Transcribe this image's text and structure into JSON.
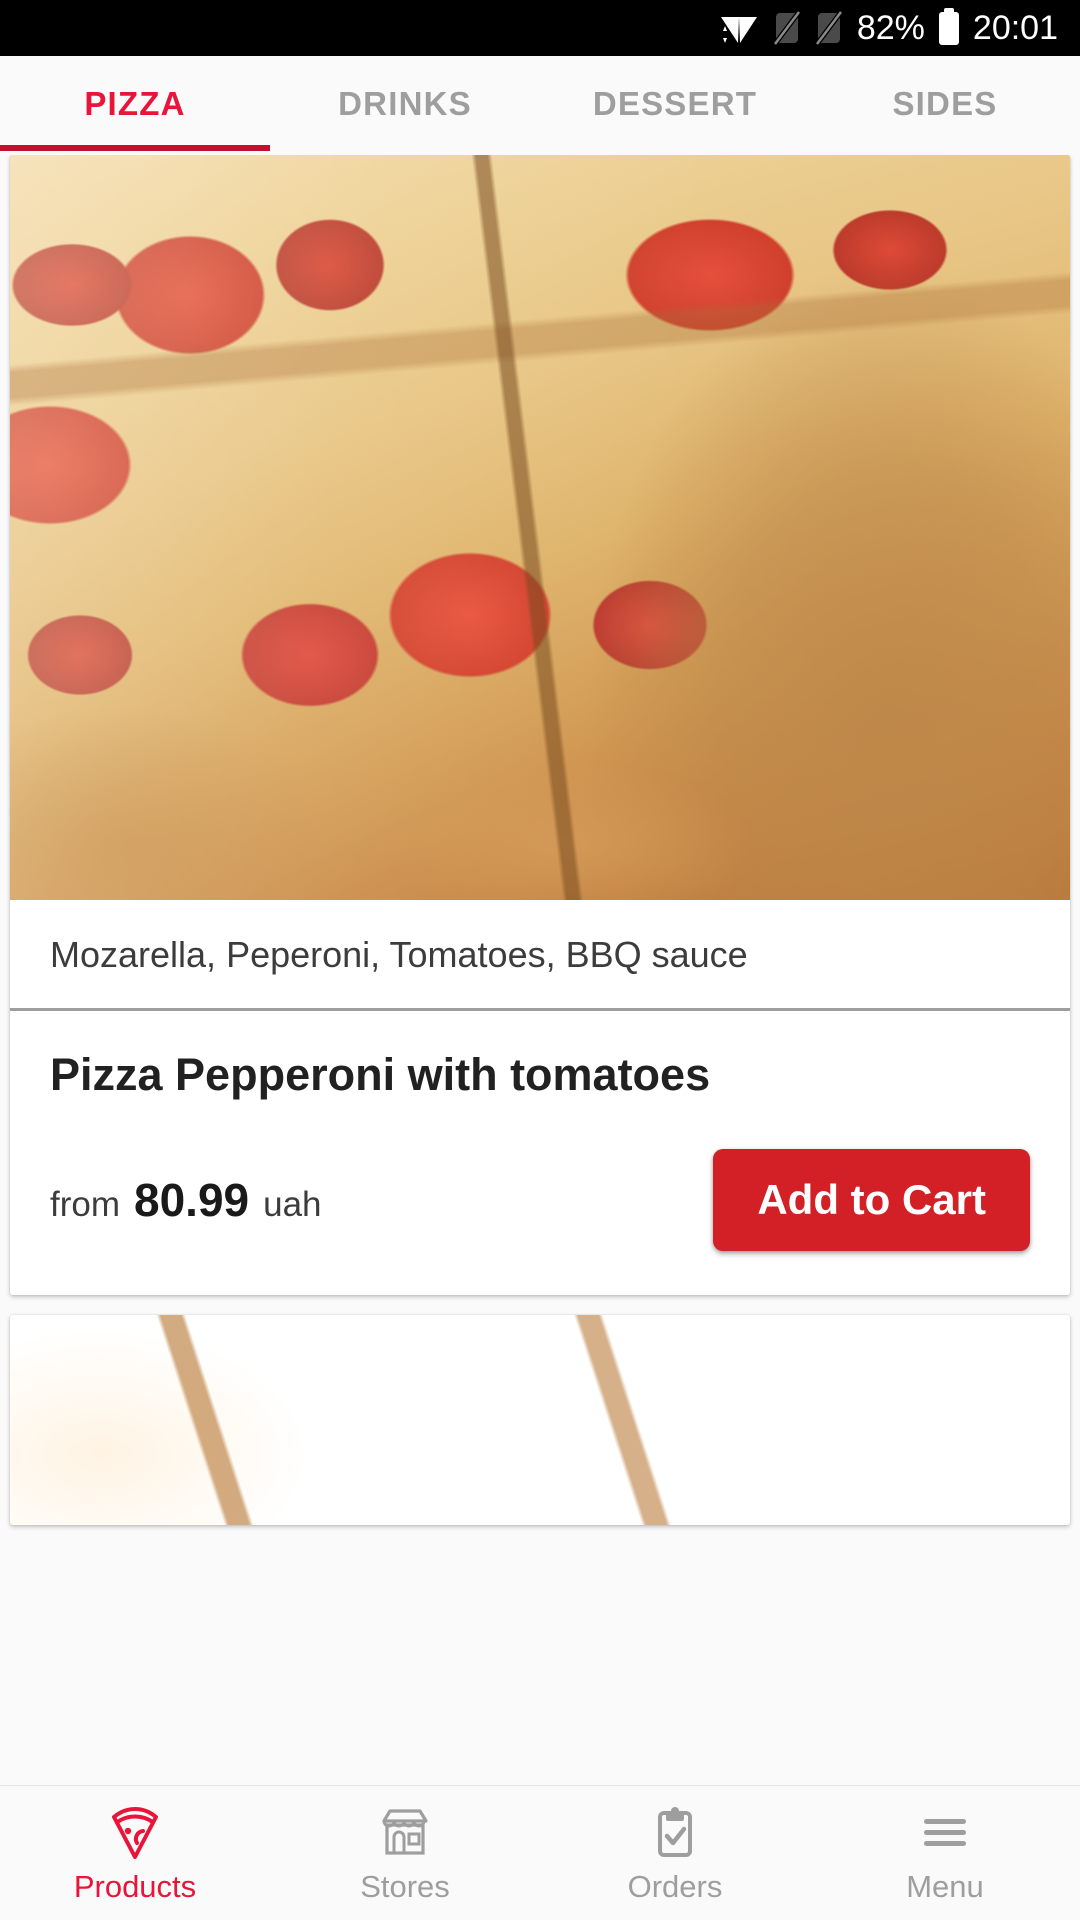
{
  "status_bar": {
    "wifi_icon": "wifi-icon",
    "sim1_icon": "sim-no-signal-icon",
    "sim2_icon": "sim-no-signal-icon",
    "battery_percent": "82%",
    "battery_icon": "battery-icon",
    "time": "20:01",
    "background": "#000000",
    "foreground": "#ffffff"
  },
  "top_tabs": {
    "active_index": 0,
    "accent_color": "#e8143a",
    "underline_color": "#c2102e",
    "inactive_color": "#9e9e9e",
    "items": [
      {
        "label": "PIZZA"
      },
      {
        "label": "DRINKS"
      },
      {
        "label": "DESSERT"
      },
      {
        "label": "SIDES"
      }
    ]
  },
  "products": [
    {
      "photo_alt": "pepperoni-pizza-slices-on-wooden-board",
      "description": "Mozarella, Peperoni, Tomatoes, BBQ sauce",
      "title": "Pizza Pepperoni with tomatoes",
      "price_prefix": "from",
      "price_value": "80.99",
      "currency": "uah",
      "cta_label": "Add to Cart",
      "cta_color": "#d32027"
    },
    {
      "photo_alt": "cheese-pizza-slices-on-wooden-board"
    }
  ],
  "bottom_nav": {
    "active_index": 0,
    "accent_color": "#e8143a",
    "inactive_color": "#9e9e9e",
    "items": [
      {
        "label": "Products",
        "icon": "pizza-slice-icon"
      },
      {
        "label": "Stores",
        "icon": "storefront-icon"
      },
      {
        "label": "Orders",
        "icon": "clipboard-check-icon"
      },
      {
        "label": "Menu",
        "icon": "hamburger-menu-icon"
      }
    ]
  }
}
